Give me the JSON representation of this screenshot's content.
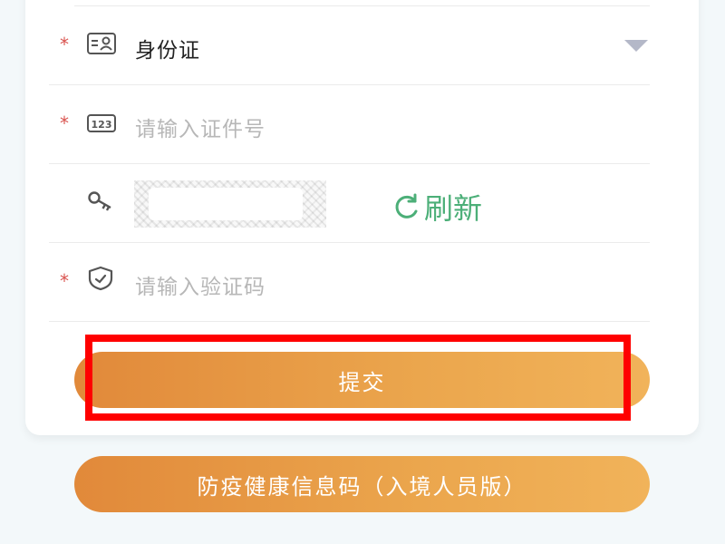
{
  "form": {
    "required_mark": "*",
    "id_type": {
      "value": "身份证",
      "icon": "id-card-icon"
    },
    "id_number": {
      "placeholder": "请输入证件号",
      "icon": "number-123-icon"
    },
    "captcha": {
      "icon": "key-icon",
      "refresh_label": "刷新",
      "refresh_icon": "refresh-icon"
    },
    "verify_code": {
      "placeholder": "请输入验证码",
      "icon": "shield-check-icon"
    }
  },
  "buttons": {
    "submit_label": "提交",
    "health_code_label": "防疫健康信息码（入境人员版）"
  },
  "colors": {
    "accent_start": "#e1893a",
    "accent_end": "#f1b35a",
    "refresh_green": "#4caf78",
    "required_red": "#d9534f",
    "highlight_red": "#ff0000"
  }
}
